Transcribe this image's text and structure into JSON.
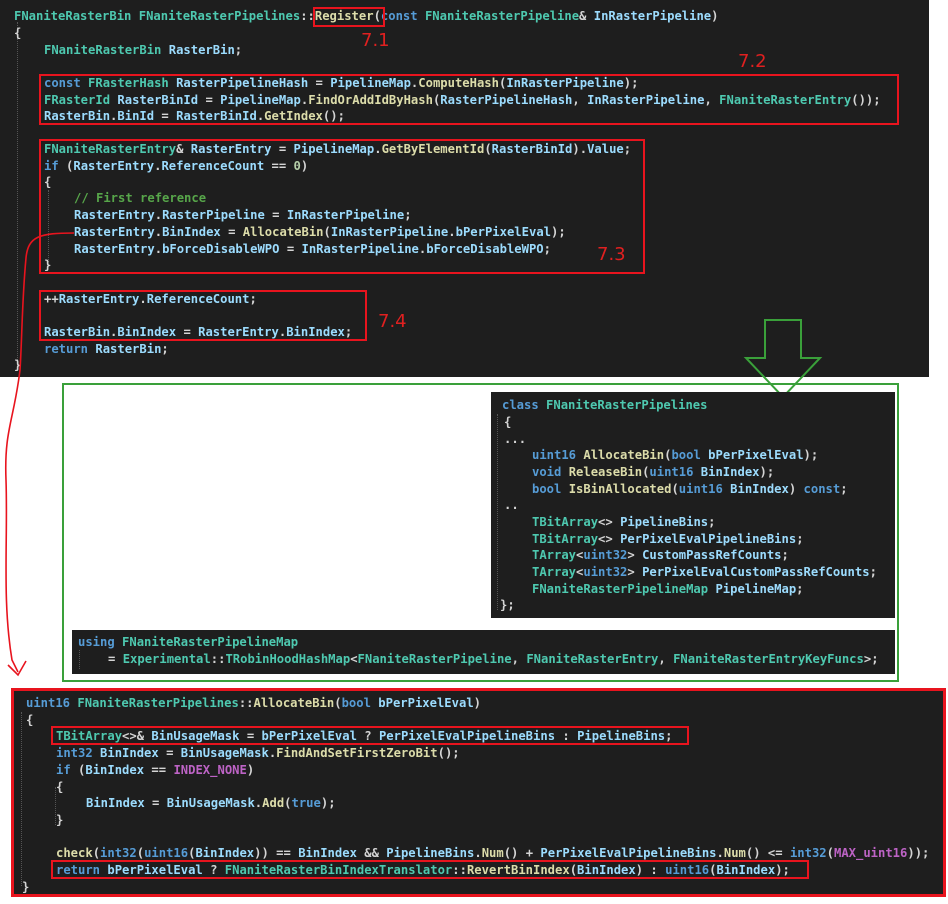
{
  "annotations": {
    "l71": "7.1",
    "l72": "7.2",
    "l73": "7.3",
    "l74": "7.4"
  },
  "panel_register": {
    "lines": [
      "FNaniteRasterBin FNaniteRasterPipelines::Register(const FNaniteRasterPipeline& InRasterPipeline)",
      "{",
      "FNaniteRasterBin RasterBin;",
      "const FRasterHash RasterPipelineHash = PipelineMap.ComputeHash(InRasterPipeline);",
      "FRasterId RasterBinId = PipelineMap.FindOrAddIdByHash(RasterPipelineHash, InRasterPipeline, FNaniteRasterEntry());",
      "RasterBin.BinId = RasterBinId.GetIndex();",
      "FNaniteRasterEntry& RasterEntry = PipelineMap.GetByElementId(RasterBinId).Value;",
      "if (RasterEntry.ReferenceCount == 0)",
      "{",
      "// First reference",
      "RasterEntry.RasterPipeline = InRasterPipeline;",
      "RasterEntry.BinIndex = AllocateBin(InRasterPipeline.bPerPixelEval);",
      "RasterEntry.bForceDisableWPO = InRasterPipeline.bForceDisableWPO;",
      "}",
      "++RasterEntry.ReferenceCount;",
      "RasterBin.BinIndex = RasterEntry.BinIndex;",
      "return RasterBin;",
      "}"
    ]
  },
  "panel_class": {
    "lines": [
      "class FNaniteRasterPipelines",
      "{",
      "...",
      "uint16 AllocateBin(bool bPerPixelEval);",
      "void ReleaseBin(uint16 BinIndex);",
      "bool IsBinAllocated(uint16 BinIndex) const;",
      "..",
      "TBitArray<> PipelineBins;",
      "TBitArray<> PerPixelEvalPipelineBins;",
      "TArray<uint32> CustomPassRefCounts;",
      "TArray<uint32> PerPixelEvalCustomPassRefCounts;",
      "FNaniteRasterPipelineMap PipelineMap;",
      "};"
    ]
  },
  "panel_using": {
    "lines": [
      "using FNaniteRasterPipelineMap",
      "= Experimental::TRobinHoodHashMap<FNaniteRasterPipeline, FNaniteRasterEntry, FNaniteRasterEntryKeyFuncs>;"
    ]
  },
  "panel_allocate": {
    "lines": [
      "uint16 FNaniteRasterPipelines::AllocateBin(bool bPerPixelEval)",
      "{",
      "TBitArray<>& BinUsageMask = bPerPixelEval ? PerPixelEvalPipelineBins : PipelineBins;",
      "int32 BinIndex = BinUsageMask.FindAndSetFirstZeroBit();",
      "if (BinIndex == INDEX_NONE)",
      "{",
      "BinIndex = BinUsageMask.Add(true);",
      "}",
      "check(int32(uint16(BinIndex)) == BinIndex && PipelineBins.Num() + PerPixelEvalPipelineBins.Num() <= int32(MAX_uint16));",
      "return bPerPixelEval ? FNaniteRasterBinIndexTranslator::RevertBinIndex(BinIndex) : uint16(BinIndex);",
      "}"
    ]
  },
  "colors": {
    "code_bg": "#1e1e1e",
    "annotation_red": "#e8141e",
    "annotation_green": "#3aa03a"
  }
}
